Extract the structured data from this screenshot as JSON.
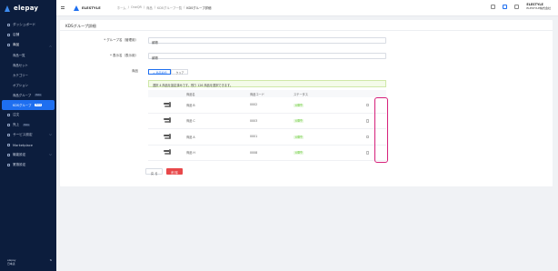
{
  "app": {
    "logo": "elepay",
    "brand": "ELESTYLE"
  },
  "sidebar": {
    "items": [
      {
        "label": "ダッシュボード",
        "icon": "dashboard-icon",
        "level": 0
      },
      {
        "label": "店舗",
        "icon": "store-icon",
        "level": 0
      },
      {
        "label": "商品",
        "icon": "product-icon",
        "level": 0,
        "expandable": true
      },
      {
        "label": "商品一覧",
        "level": 1
      },
      {
        "label": "商品セット",
        "level": 1
      },
      {
        "label": "カテゴリー",
        "level": 1
      },
      {
        "label": "オプション",
        "level": 1
      },
      {
        "label": "商品グループ",
        "level": 1,
        "badge": "Beta"
      },
      {
        "label": "KDSグループ",
        "level": 1,
        "badge": "Beta",
        "active": true
      },
      {
        "label": "注文",
        "icon": "order-icon",
        "level": 0
      },
      {
        "label": "売上",
        "icon": "sales-icon",
        "level": 0,
        "badge": "Beta"
      },
      {
        "label": "サービス設定",
        "icon": "service-icon",
        "level": 0,
        "expandable": true
      },
      {
        "label": "Marketplace",
        "icon": "marketplace-icon",
        "level": 0
      },
      {
        "label": "機能設定",
        "icon": "feature-icon",
        "level": 0,
        "expandable": true
      },
      {
        "label": "業態設定",
        "icon": "business-icon",
        "level": 0
      }
    ],
    "footer_left": "elepay",
    "footer_sub": "日本語"
  },
  "header": {
    "breadcrumbs": [
      "ホーム",
      "OneQR",
      "商品",
      "KDSグループ一覧",
      "KDSグループ詳細"
    ],
    "user_name": "ELESTYLE",
    "user_sub": "ELESTYLE株式会社"
  },
  "page": {
    "title": "KDSグループ詳細",
    "group_name_label": "* グループ名（管理用）",
    "group_name_value": "焼物",
    "display_name_label": "* 表示名（表示用）",
    "display_name_value": "焼物",
    "product_label": "商品",
    "radio_add": "+ 商品追加",
    "radio_clear": "クリア",
    "alert_text": "選択 4 商品を設定済みです。残り 126 商品を選択できます。",
    "table": {
      "headers": [
        "",
        "商品名",
        "商品コード",
        "ステータス",
        ""
      ],
      "rows": [
        {
          "name": "商品 B",
          "code": "0002",
          "status": "公開中"
        },
        {
          "name": "商品 C",
          "code": "0003",
          "status": "公開中"
        },
        {
          "name": "商品 A",
          "code": "0001",
          "status": "公開中"
        },
        {
          "name": "商品 H",
          "code": "0008",
          "status": "公開中"
        }
      ]
    },
    "buttons": {
      "back": "戻 る",
      "delete": "削 除"
    }
  },
  "colors": {
    "accent": "#1e6ff0",
    "sidebar_bg": "#0c1d3d",
    "danger": "#e8484a",
    "success": "#52c41a",
    "highlight": "#d6207a"
  }
}
